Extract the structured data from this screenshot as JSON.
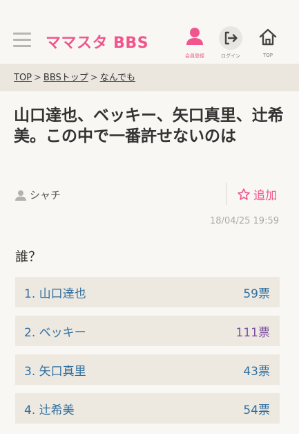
{
  "header": {
    "logo": "ママスタ BBS",
    "register_label": "会員登録",
    "login_label": "ログイン",
    "top_label": "TOP",
    "accent_color": "#f0568d"
  },
  "breadcrumb": {
    "items": [
      "TOP",
      "BBSトップ",
      "なんでも"
    ],
    "separator": ">"
  },
  "thread": {
    "title": "山口達也、ベッキー、矢口真里、辻希美。この中で一番許せないのは",
    "author": "シャチ",
    "favorite_label": "追加",
    "date": "18/04/25 19:59",
    "question": "誰？"
  },
  "poll": {
    "choices": [
      {
        "label": "1. 山口達也",
        "votes": "59票"
      },
      {
        "label": "2. ベッキー",
        "votes": "111票"
      },
      {
        "label": "3. 矢口真里",
        "votes": "43票"
      },
      {
        "label": "4. 辻希美",
        "votes": "54票"
      }
    ]
  },
  "icons": {
    "menu": "hamburger-menu-icon",
    "register": "user-icon",
    "login": "login-arrow-icon",
    "top": "home-icon",
    "author": "user-icon",
    "favorite": "star-outline-icon"
  }
}
